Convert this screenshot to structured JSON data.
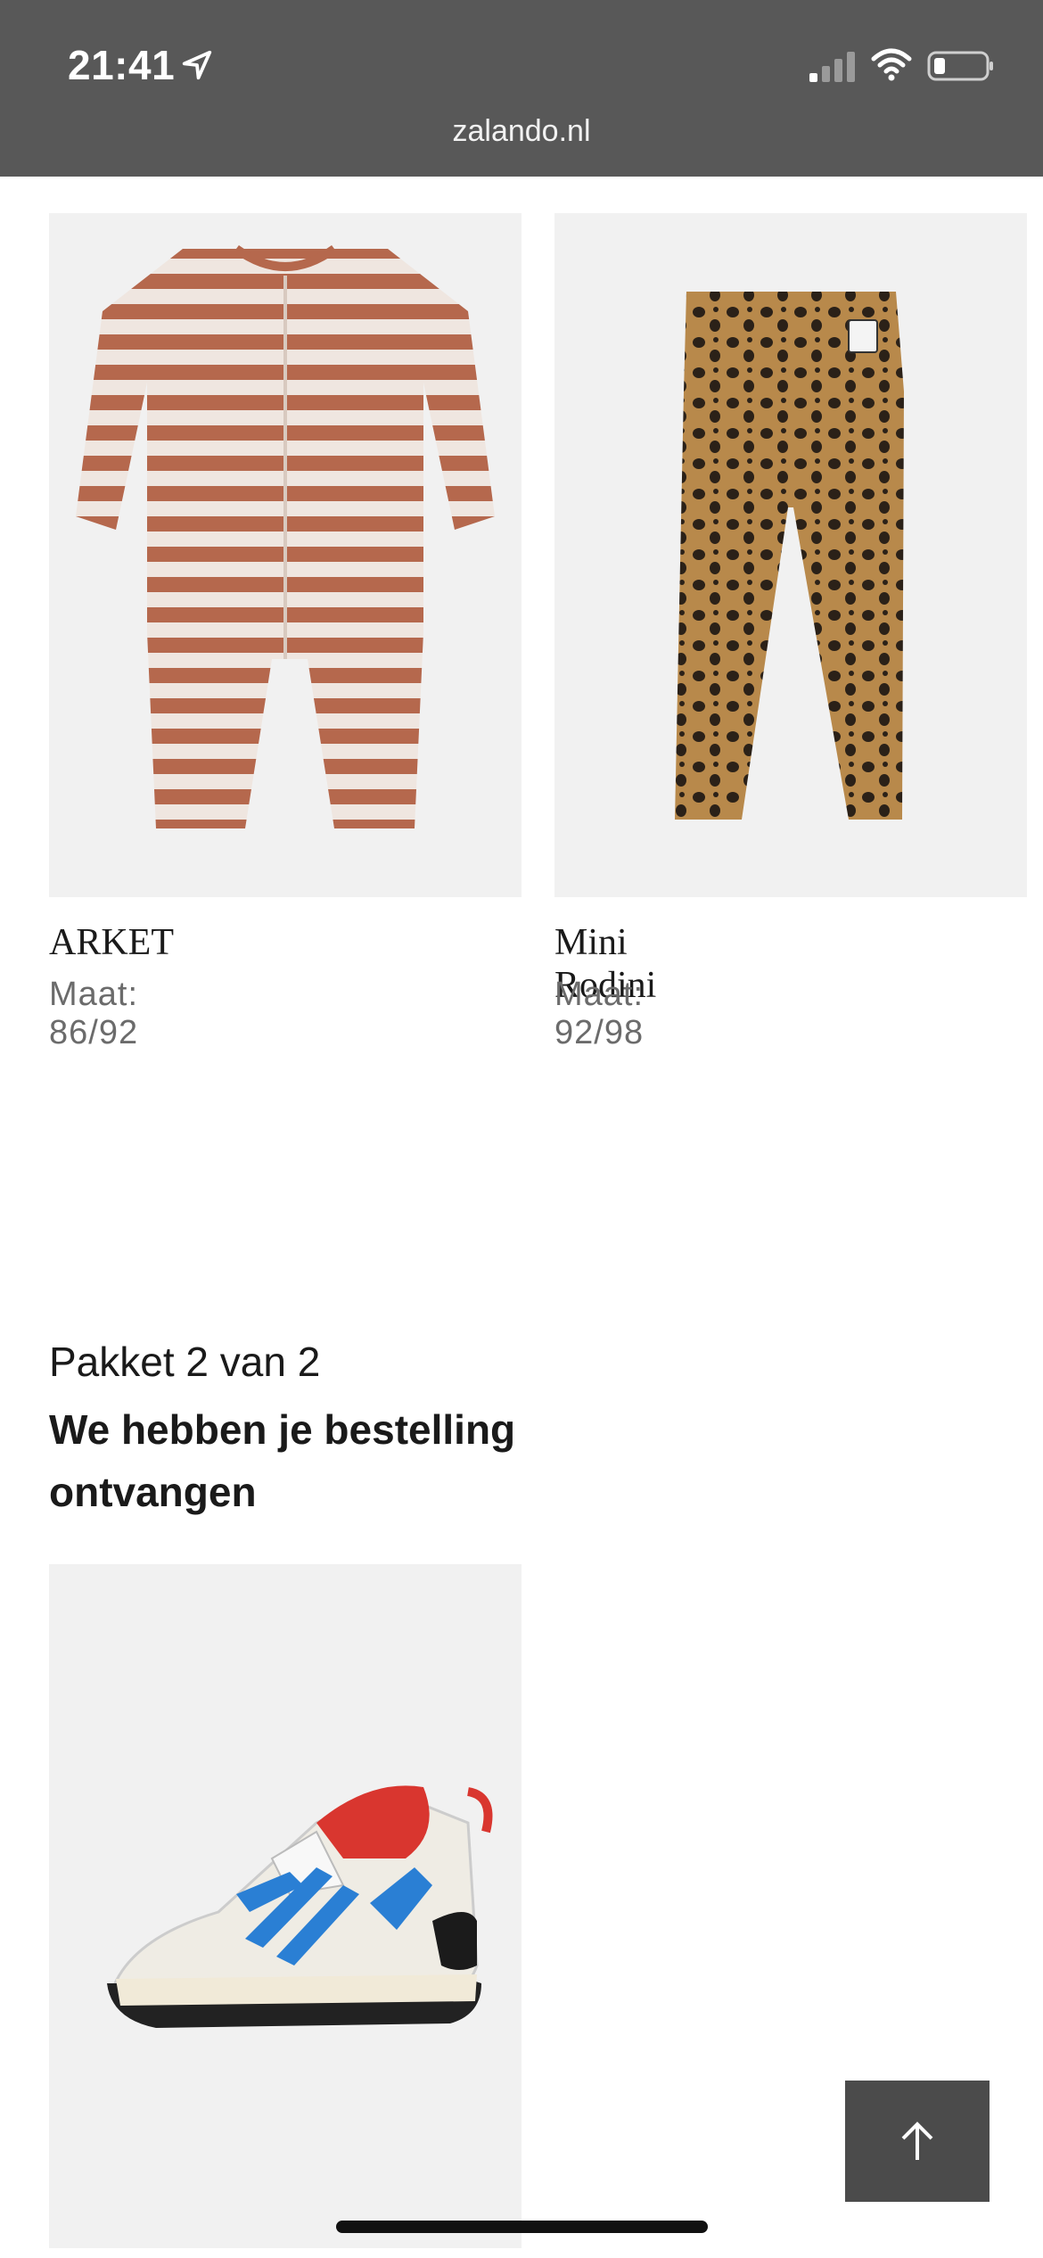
{
  "status_bar": {
    "time": "21:41",
    "url": "zalando.nl",
    "icons": [
      "location-arrow-icon",
      "signal-icon",
      "wifi-icon",
      "battery-icon"
    ]
  },
  "package1": {
    "items": [
      {
        "brand": "ARKET",
        "size": "Maat: 86/92",
        "image": "striped-baby-romper"
      },
      {
        "brand": "Mini Rodini",
        "size": "Maat: 92/98",
        "image": "leopard-leggings"
      }
    ]
  },
  "package2": {
    "count": "Pakket 2 van 2",
    "title": "We hebben je bestelling ontvangen",
    "items": [
      {
        "image": "adidas-kids-sneaker"
      }
    ]
  },
  "colors": {
    "status_bar_bg": "#585858",
    "image_bg": "#f1f1f1",
    "back_to_top_bg": "#4b4b4b",
    "size_text": "#6b6b6b"
  }
}
